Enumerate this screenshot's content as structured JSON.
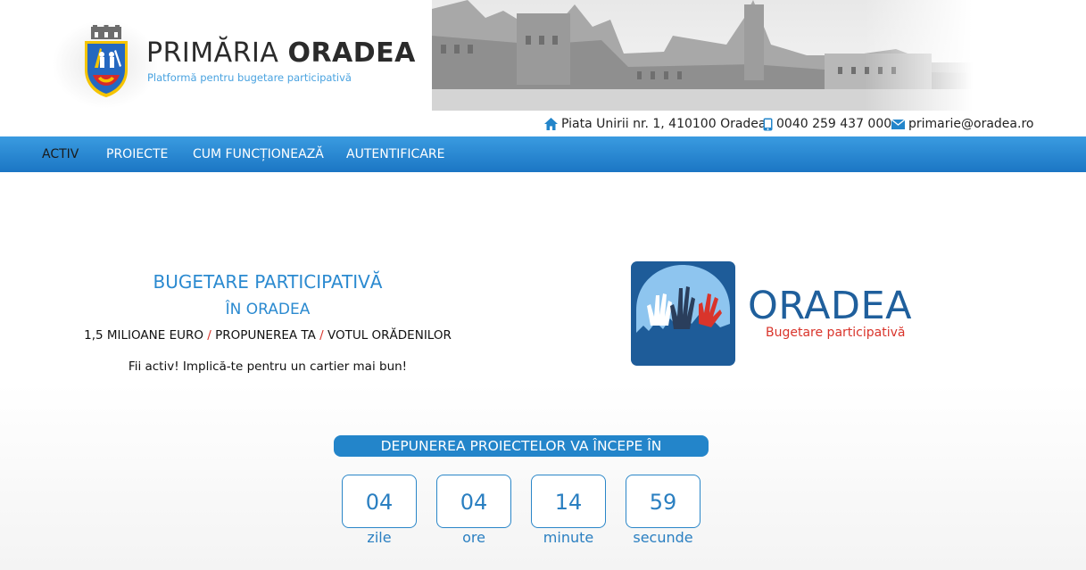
{
  "header": {
    "title_light": "PRIMĂRIA ",
    "title_bold": "ORADEA",
    "subtitle": "Platformă pentru bugetare participativă",
    "contact": {
      "address": "Piata Unirii nr. 1, 410100 Oradea",
      "phone": "0040 259 437 000",
      "email": "primarie@oradea.ro"
    }
  },
  "nav": {
    "items": [
      {
        "label": "ACTIV"
      },
      {
        "label": "PROIECTE"
      },
      {
        "label": "CUM FUNCȚIONEAZĂ"
      },
      {
        "label": "AUTENTIFICARE"
      }
    ]
  },
  "hero": {
    "title": "BUGETARE PARTICIPATIVĂ",
    "subtitle": "ÎN ORADEA",
    "pillars": [
      "1,5 MILIOANE EURO",
      "PROPUNEREA TA",
      "VOTUL ORĂDENILOR"
    ],
    "separator": "/",
    "tagline": "Fii activ! Implică-te pentru un cartier mai bun!"
  },
  "brand": {
    "word": "ORADEA",
    "sub": "Bugetare participativă"
  },
  "countdown": {
    "banner": "DEPUNEREA PROIECTELOR VA ÎNCEPE ÎN",
    "units": [
      {
        "value": "04",
        "label": "zile"
      },
      {
        "value": "04",
        "label": "ore"
      },
      {
        "value": "14",
        "label": "minute"
      },
      {
        "value": "59",
        "label": "secunde"
      }
    ]
  },
  "colors": {
    "accent": "#2385ca",
    "brand_blue": "#1f5f9c",
    "brand_red": "#d9342b",
    "nav_top": "#3a9be0",
    "nav_bottom": "#1b76c4"
  },
  "icons": [
    "home-icon",
    "phone-icon",
    "mail-icon",
    "city-crest-icon"
  ]
}
